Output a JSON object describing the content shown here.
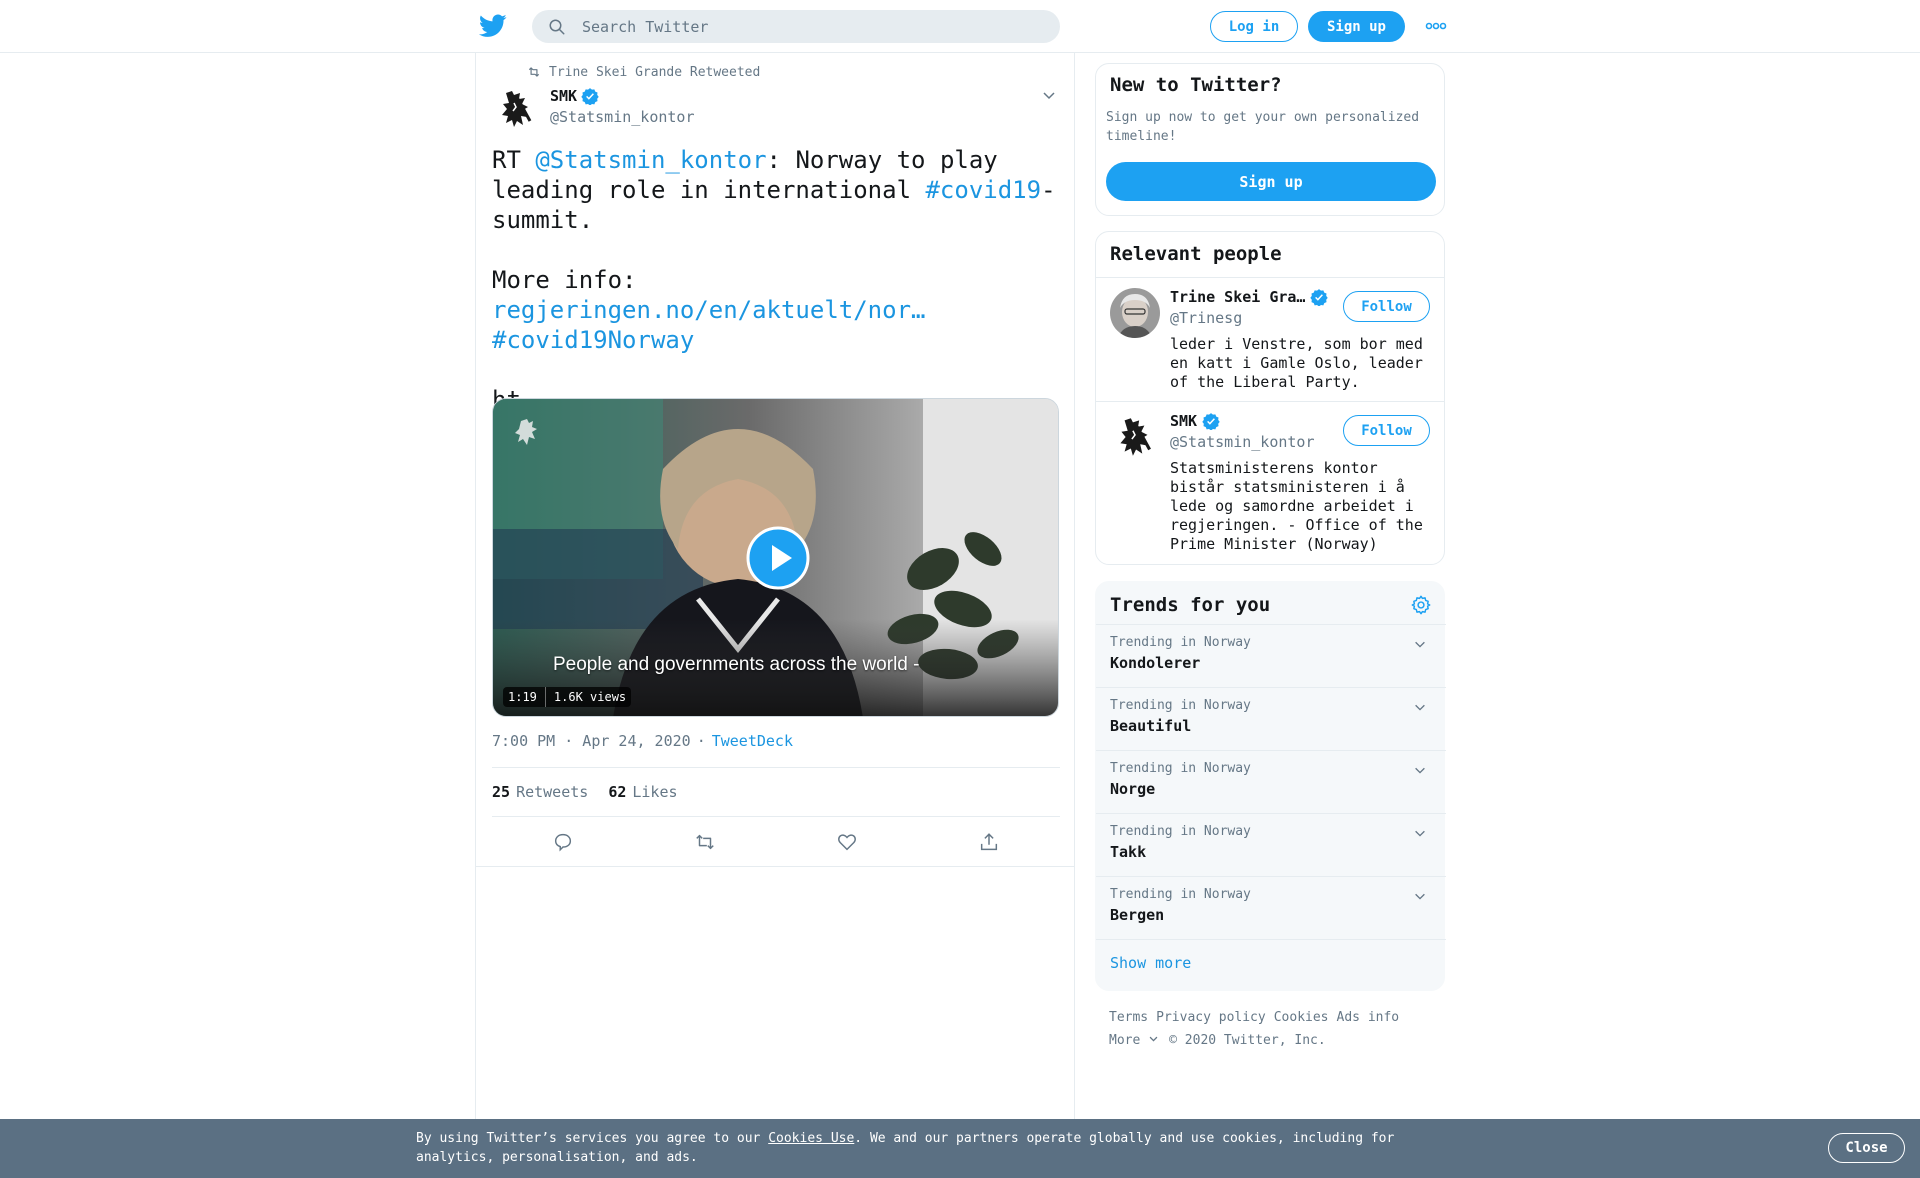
{
  "header": {
    "search_placeholder": "Search Twitter",
    "login_label": "Log in",
    "signup_label": "Sign up"
  },
  "tweet": {
    "retweet_context": "Trine Skei Grande Retweeted",
    "author_name": "SMK",
    "author_handle": "@Statsmin_kontor",
    "text_prefix": "RT ",
    "mention": "@Statsmin_kontor",
    "text_mid": ": Norway to play leading role in international ",
    "hashtag1": "#covid19",
    "text_after_hashtag": "-summit.",
    "more_info_label": "More info: ",
    "link": "regjeringen.no/en/aktuelt/nor…",
    "hashtag2": "#covid19Norway",
    "truncated": "ht…",
    "video_caption": "People and governments across the world -",
    "video_duration": "1:19",
    "video_views": "1.6K views",
    "timestamp": "7:00 PM · Apr 24, 2020",
    "separator": "·",
    "source": "TweetDeck",
    "retweets_count": "25",
    "retweets_label": "Retweets",
    "likes_count": "62",
    "likes_label": "Likes"
  },
  "sidebar": {
    "new_to_twitter": {
      "title": "New to Twitter?",
      "subtitle": "Sign up now to get your own personalized timeline!",
      "button": "Sign up"
    },
    "relevant_people": {
      "title": "Relevant people",
      "people": [
        {
          "name": "Trine Skei Gra…",
          "handle": "@Trinesg",
          "bio": "leder i Venstre, som bor med en katt i Gamle Oslo, leader of the Liberal Party.",
          "follow": "Follow"
        },
        {
          "name": "SMK",
          "handle": "@Statsmin_kontor",
          "bio": "Statsministerens kontor bistår statsministeren i å lede og samordne arbeidet i regjeringen. - Office of the Prime Minister (Norway)",
          "follow": "Follow"
        }
      ]
    },
    "trends": {
      "title": "Trends for you",
      "items": [
        {
          "context": "Trending in Norway",
          "name": "Kondolerer"
        },
        {
          "context": "Trending in Norway",
          "name": "Beautiful"
        },
        {
          "context": "Trending in Norway",
          "name": "Norge"
        },
        {
          "context": "Trending in Norway",
          "name": "Takk"
        },
        {
          "context": "Trending in Norway",
          "name": "Bergen"
        }
      ],
      "show_more": "Show more"
    },
    "footer": {
      "terms": "Terms",
      "privacy": "Privacy policy",
      "cookies": "Cookies",
      "ads_info": "Ads info",
      "more": "More",
      "copyright": "© 2020 Twitter, Inc."
    }
  },
  "cookie_bar": {
    "text_before": "By using Twitter’s services you agree to our ",
    "link": "Cookies Use",
    "text_after": ". We and our partners operate globally and use cookies, including for analytics, personalisation, and ads.",
    "close": "Close"
  },
  "colors": {
    "accent": "#1da1f2",
    "link": "#1b95e0",
    "muted": "#657786",
    "cookie_bar": "#5b7083"
  }
}
